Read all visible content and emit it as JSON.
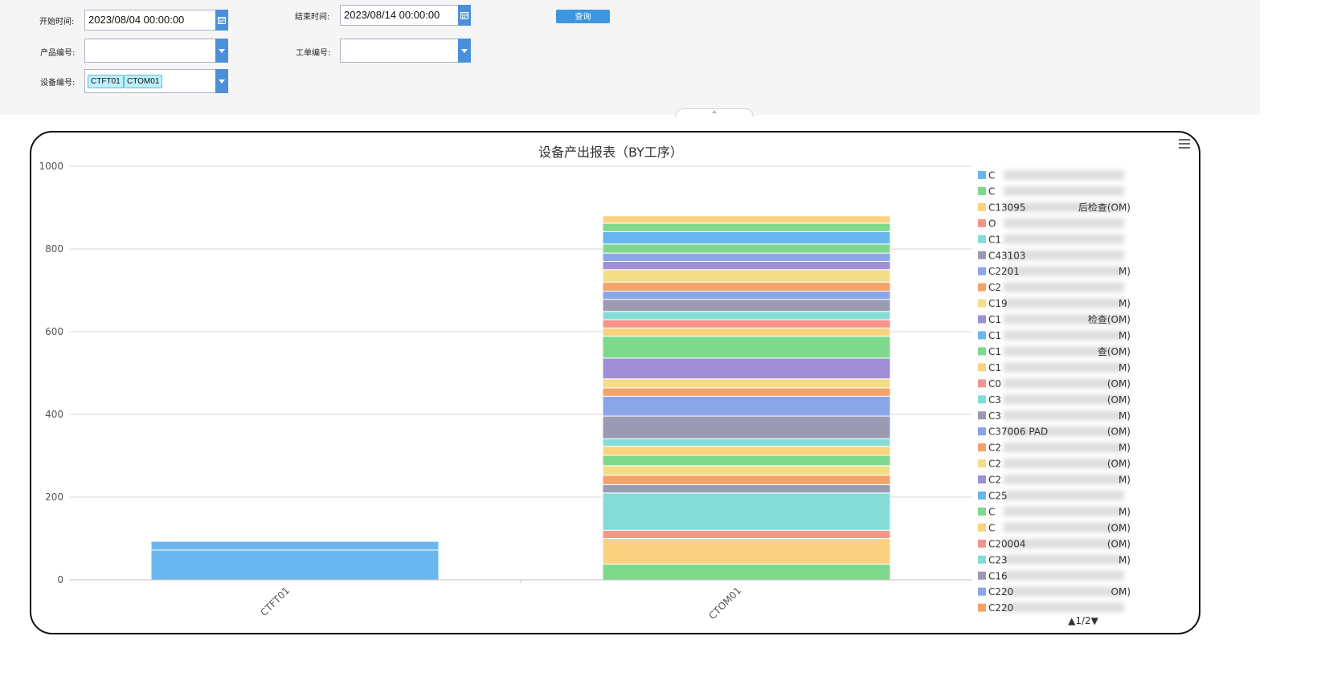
{
  "filters": {
    "start_time": {
      "label": "开始时间:",
      "value": "2023/08/04 00:00:00"
    },
    "end_time": {
      "label": "结束时间:",
      "value": "2023/08/14 00:00:00"
    },
    "query_button": "查询",
    "product_no": {
      "label": "产品编号:",
      "value": ""
    },
    "work_order_no": {
      "label": "工单编号:",
      "value": ""
    },
    "equipment_no": {
      "label": "设备编号:",
      "tags": [
        "CTFT01",
        "CTOM01"
      ]
    }
  },
  "colors": {
    "accent": "#3d97e0",
    "palette": [
      "#6ab7f0",
      "#7ed98c",
      "#fbd27f",
      "#f6968b",
      "#84dcd6",
      "#9a9bb3",
      "#8ba6e8",
      "#f3a469",
      "#f3de86",
      "#a08fd6"
    ]
  },
  "chart_data": {
    "type": "bar",
    "stacked": true,
    "title": "设备产出报表（BY工序）",
    "xlabel": "",
    "ylabel": "",
    "ylim": [
      0,
      1000
    ],
    "yticks": [
      0,
      200,
      400,
      600,
      800,
      1000
    ],
    "grid": true,
    "legend_position": "right",
    "legend_page": "1/2",
    "categories": [
      "CTFT01",
      "CTOM01"
    ],
    "stacks": {
      "CTFT01": [
        {
          "value": 72,
          "color": "#6ab7f0"
        },
        {
          "value": 21,
          "color": "#6ab7f0"
        }
      ],
      "CTOM01": [
        {
          "value": 38,
          "color": "#7ed98c"
        },
        {
          "value": 62,
          "color": "#fbd27f"
        },
        {
          "value": 20,
          "color": "#f6968b"
        },
        {
          "value": 90,
          "color": "#84dcd6"
        },
        {
          "value": 20,
          "color": "#9a9bb3"
        },
        {
          "value": 23,
          "color": "#f3a469"
        },
        {
          "value": 23,
          "color": "#f3de86"
        },
        {
          "value": 25,
          "color": "#7ed98c"
        },
        {
          "value": 22,
          "color": "#fbd27f"
        },
        {
          "value": 18,
          "color": "#84dcd6"
        },
        {
          "value": 55,
          "color": "#9a9bb3"
        },
        {
          "value": 48,
          "color": "#8ba6e8"
        },
        {
          "value": 20,
          "color": "#f3a469"
        },
        {
          "value": 22,
          "color": "#f3de86"
        },
        {
          "value": 50,
          "color": "#a08fd6"
        },
        {
          "value": 53,
          "color": "#7ed98c"
        },
        {
          "value": 20,
          "color": "#fbd27f"
        },
        {
          "value": 20,
          "color": "#f6968b"
        },
        {
          "value": 20,
          "color": "#84dcd6"
        },
        {
          "value": 29,
          "color": "#9a9bb3"
        },
        {
          "value": 20,
          "color": "#8ba6e8"
        },
        {
          "value": 22,
          "color": "#f3a469"
        },
        {
          "value": 30,
          "color": "#f3de86"
        },
        {
          "value": 20,
          "color": "#a08fd6"
        },
        {
          "value": 20,
          "color": "#8ba6e8"
        },
        {
          "value": 22,
          "color": "#7ed98c"
        },
        {
          "value": 30,
          "color": "#6ab7f0"
        },
        {
          "value": 20,
          "color": "#7ed98c"
        },
        {
          "value": 18,
          "color": "#fbd27f"
        }
      ]
    },
    "legend": [
      {
        "label": "C",
        "color": "#6ab7f0",
        "blurred": true
      },
      {
        "label": "C",
        "color": "#7ed98c",
        "blurred": true
      },
      {
        "label": "C13095",
        "label_end": "后检查(OM)",
        "color": "#fbd27f"
      },
      {
        "label": "O",
        "color": "#f6968b",
        "blurred": true
      },
      {
        "label": "C1",
        "color": "#84dcd6",
        "blurred": true
      },
      {
        "label": "C43103",
        "color": "#9a9bb3",
        "blurred": true
      },
      {
        "label": "C2201",
        "label_end": "M)",
        "color": "#8ba6e8"
      },
      {
        "label": "C2",
        "color": "#f3a469",
        "blurred": true
      },
      {
        "label": "C19",
        "label_end": "M)",
        "color": "#f3de86"
      },
      {
        "label": "C1",
        "label_end": "检查(OM)",
        "color": "#a08fd6"
      },
      {
        "label": "C1",
        "label_end": "M)",
        "color": "#6ab7f0"
      },
      {
        "label": "C1",
        "label_end": "查(OM)",
        "color": "#7ed98c"
      },
      {
        "label": "C1",
        "label_end": "M)",
        "color": "#fbd27f"
      },
      {
        "label": "C0",
        "label_end": "(OM)",
        "color": "#f6968b"
      },
      {
        "label": "C3",
        "label_end": "(OM)",
        "color": "#84dcd6"
      },
      {
        "label": "C3",
        "label_end": "M)",
        "color": "#9a9bb3"
      },
      {
        "label": "C37006 PAD",
        "label_end": "(OM)",
        "color": "#8ba6e8"
      },
      {
        "label": "C2",
        "label_end": "M)",
        "color": "#f3a469"
      },
      {
        "label": "C2",
        "label_end": "(OM)",
        "color": "#f3de86"
      },
      {
        "label": "C2",
        "label_end": "M)",
        "color": "#a08fd6"
      },
      {
        "label": "C25",
        "color": "#6ab7f0",
        "blurred": true
      },
      {
        "label": "C",
        "label_end": "M)",
        "color": "#7ed98c"
      },
      {
        "label": "C",
        "label_end": "(OM)",
        "color": "#fbd27f"
      },
      {
        "label": "C20004",
        "label_end": "(OM)",
        "color": "#f6968b"
      },
      {
        "label": "C23",
        "label_end": "M)",
        "color": "#84dcd6"
      },
      {
        "label": "C16",
        "color": "#9a9bb3",
        "blurred": true
      },
      {
        "label": "C220",
        "label_end": "OM)",
        "color": "#8ba6e8"
      },
      {
        "label": "C220",
        "color": "#f3a469",
        "blurred": true
      }
    ]
  }
}
